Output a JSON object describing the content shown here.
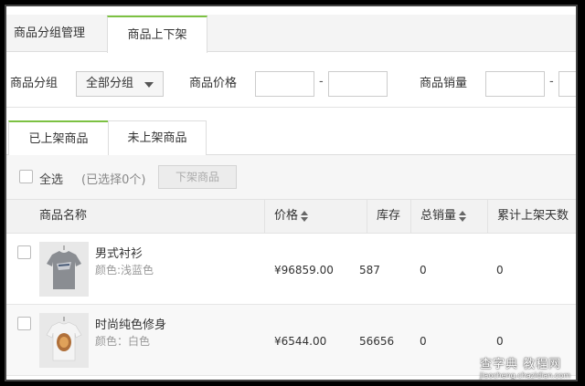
{
  "top_tabs": [
    {
      "label": "商品分组管理"
    },
    {
      "label": "商品上下架"
    }
  ],
  "filters": {
    "group_label": "商品分组",
    "group_value": "全部分组",
    "price_label": "商品价格",
    "sales_label": "商品销量",
    "dash": "-"
  },
  "sub_tabs": [
    {
      "label": "已上架商品"
    },
    {
      "label": "未上架商品"
    }
  ],
  "toolbar": {
    "select_all": "全选",
    "selected_count": "(已选择0个)",
    "off_shelf_button": "下架商品"
  },
  "table": {
    "headers": [
      "商品名称",
      "价格",
      "库存",
      "总销量",
      "累计上架天数"
    ],
    "rows": [
      {
        "name": "男式衬衫",
        "color": "颜色:浅蓝色",
        "price": "¥96859.00",
        "stock": "587",
        "sales": "0",
        "days": "0"
      },
      {
        "name": "时尚纯色修身",
        "color": "颜色：白色",
        "price": "¥6544.00",
        "stock": "56656",
        "sales": "0",
        "days": "0"
      }
    ]
  },
  "watermark": {
    "title": "查字典 教程网",
    "url": "jiaocheng.chazidian.com"
  },
  "colors": {
    "accent": "#7cc142"
  }
}
